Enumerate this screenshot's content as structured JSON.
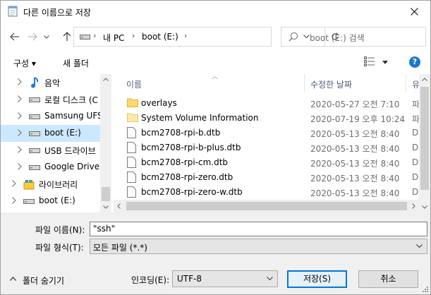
{
  "window": {
    "title": "다른 이름으로 저장"
  },
  "address": {
    "crumbs": [
      "내 PC",
      "boot (E:)"
    ],
    "search_placeholder": "boot (E:) 검색"
  },
  "toolbar": {
    "organize": "구성 ▾",
    "new_folder": "새 폴더",
    "help": "?"
  },
  "nav_tree": [
    {
      "label": "음악",
      "icon": "music-icon"
    },
    {
      "label": "로컬 디스크 (C",
      "icon": "drive-icon"
    },
    {
      "label": "Samsung UFS",
      "icon": "drive-icon"
    },
    {
      "label": "boot (E:)",
      "icon": "drive-icon",
      "selected": true
    },
    {
      "label": "USB 드라이브",
      "icon": "drive-icon"
    },
    {
      "label": "Google Drive F",
      "icon": "drive-icon"
    },
    {
      "label": "라이브러리",
      "icon": "library-icon"
    },
    {
      "label": "boot (E:)",
      "icon": "drive-icon"
    }
  ],
  "columns": {
    "name": "이름",
    "date": "수정한 날짜",
    "type": "유"
  },
  "files": [
    {
      "name": "overlays",
      "date": "2020-05-27 오전 7:10",
      "type": "파",
      "kind": "folder"
    },
    {
      "name": "System Volume Information",
      "date": "2020-07-19 오후 10:24",
      "type": "파",
      "kind": "folder"
    },
    {
      "name": "bcm2708-rpi-b.dtb",
      "date": "2020-05-13 오전 8:40",
      "type": "D",
      "kind": "file"
    },
    {
      "name": "bcm2708-rpi-b-plus.dtb",
      "date": "2020-05-13 오전 8:40",
      "type": "D",
      "kind": "file"
    },
    {
      "name": "bcm2708-rpi-cm.dtb",
      "date": "2020-05-13 오전 8:40",
      "type": "D",
      "kind": "file"
    },
    {
      "name": "bcm2708-rpi-zero.dtb",
      "date": "2020-05-13 오전 8:40",
      "type": "D",
      "kind": "file"
    },
    {
      "name": "bcm2708-rpi-zero-w.dtb",
      "date": "2020-05-13 오전 8:40",
      "type": "D",
      "kind": "file"
    }
  ],
  "form": {
    "filename_label": "파일 이름(N):",
    "filename_value": "\"ssh\"",
    "filetype_label": "파일 형식(T):",
    "filetype_value": "모든 파일 (*.*)",
    "encoding_label": "인코딩(E):",
    "encoding_value": "UTF-8",
    "save": "저장(S)",
    "cancel": "취소",
    "hide_folders": "폴더 숨기기"
  },
  "colors": {
    "selection": "#cce8ff",
    "accent": "#0078d7",
    "folder": "#ffd767"
  }
}
